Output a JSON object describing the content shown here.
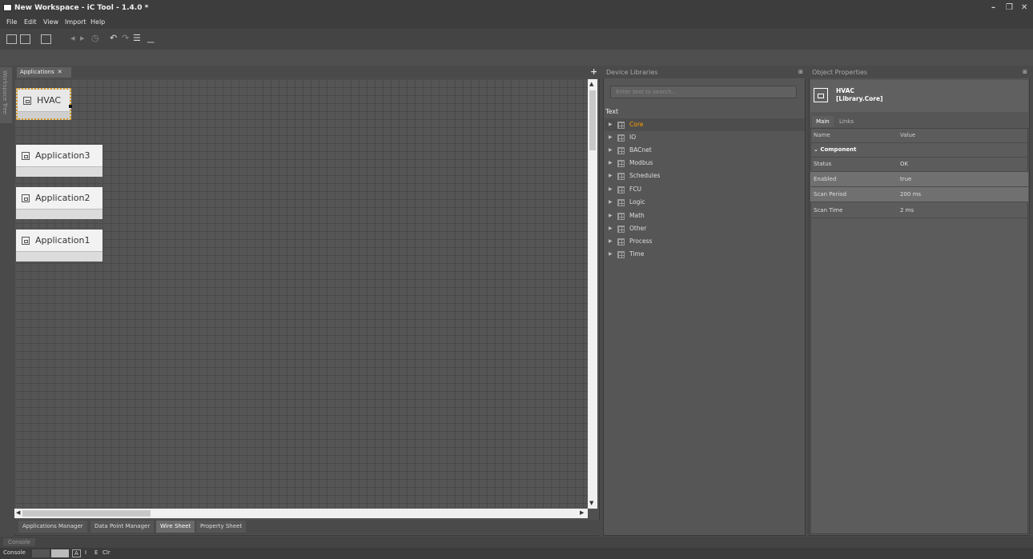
{
  "window": {
    "title": "New Workspace - iC Tool - 1.4.0 *"
  },
  "menu": [
    "File",
    "Edit",
    "View",
    "Import",
    "Help"
  ],
  "side_panel": {
    "label": "Workspace Tree"
  },
  "applications_panel": {
    "tab_label": "Applications",
    "close_glyph": "✕",
    "add_glyph": "+",
    "nodes": [
      {
        "label": "HVAC",
        "selected": true
      },
      {
        "label": "Application3"
      },
      {
        "label": "Application2"
      },
      {
        "label": "Application1"
      }
    ],
    "bottom_tabs": [
      "Applications Manager",
      "Data Point Manager",
      "Wire Sheet",
      "Property Sheet"
    ],
    "active_bottom_tab": "Wire Sheet"
  },
  "device_libraries": {
    "title": "Device Libraries",
    "search_placeholder": "Enter text to search...",
    "column_header": "Text",
    "items": [
      "Core",
      "IO",
      "BACnet",
      "Modbus",
      "Schedules",
      "FCU",
      "Logic",
      "Math",
      "Other",
      "Process",
      "Time"
    ],
    "selected": "Core"
  },
  "object_properties": {
    "title": "Object Properties",
    "object_name": "HVAC",
    "object_type": "[Library.Core]",
    "tabs": [
      "Main",
      "Links"
    ],
    "active_tab": "Main",
    "columns": {
      "name": "Name",
      "value": "Value"
    },
    "group": "Component",
    "rows": [
      {
        "name": "Status",
        "value": "OK"
      },
      {
        "name": "Enabled",
        "value": "true"
      },
      {
        "name": "Scan Period",
        "value": "200 ms"
      },
      {
        "name": "Scan Time",
        "value": "2 ms"
      }
    ]
  },
  "console": {
    "tab": "Console",
    "label": "Console",
    "btn_a": "A",
    "btn_i": "I",
    "btn_e": "E",
    "btn_clr": "Clr"
  },
  "colors": {
    "selected_library": "#ff9d00",
    "selection_border": "#d49a20"
  }
}
